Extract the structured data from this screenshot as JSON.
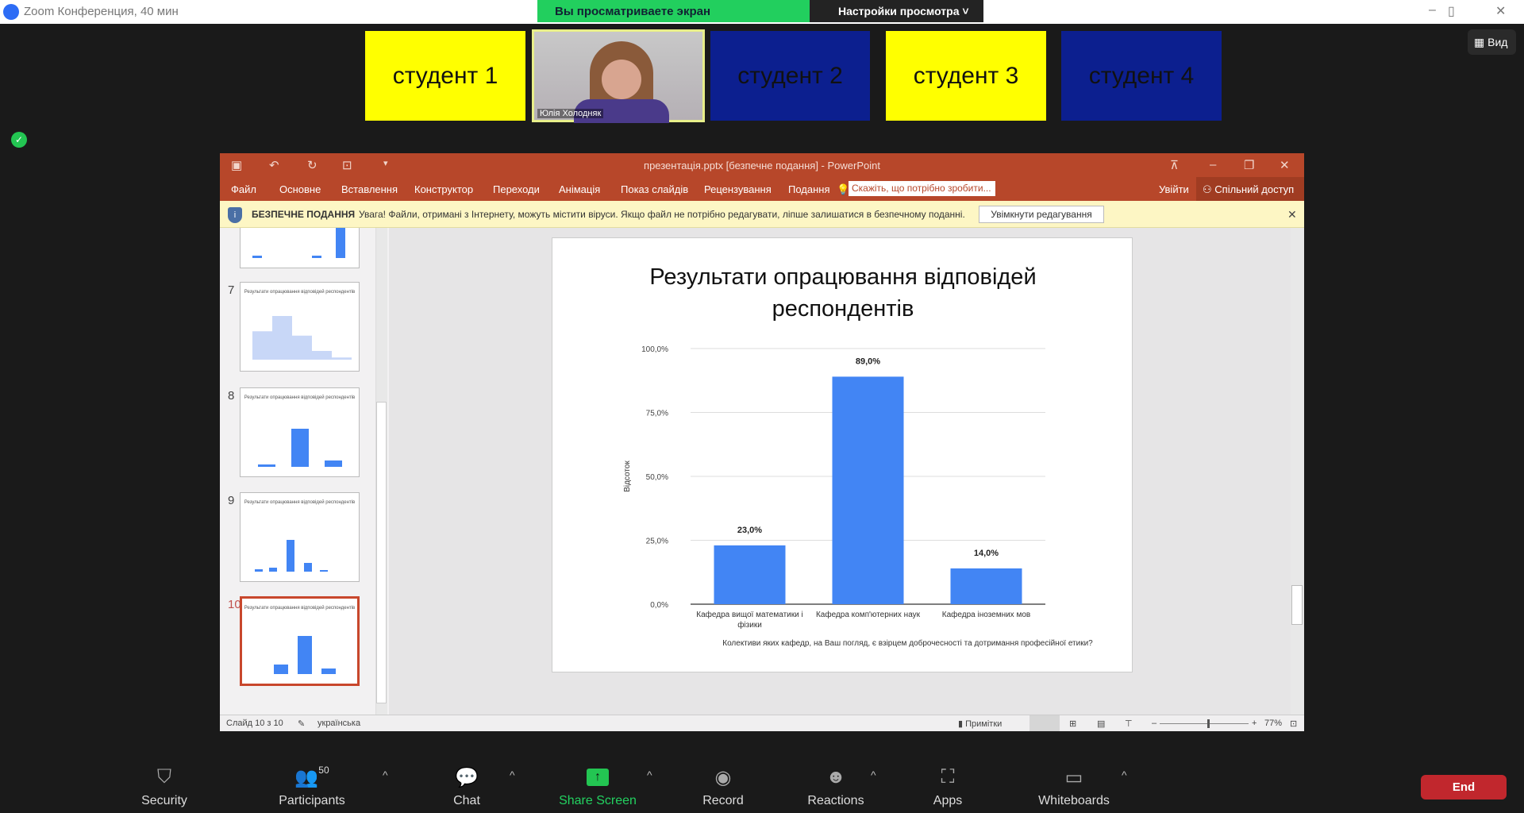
{
  "zoom": {
    "title": "Zoom Конференция, 40 мин",
    "logo": "zoom",
    "viewing_banner": "Вы просматриваете экран",
    "view_settings": "Настройки просмотра",
    "view_button": "Вид"
  },
  "tiles": [
    {
      "label": "студент 1",
      "color": "#ffff00"
    },
    {
      "label": "Юлія Холодняк",
      "color": "video"
    },
    {
      "label": "студент 2",
      "color": "#0c1f8f"
    },
    {
      "label": "студент 3",
      "color": "#ffff00"
    },
    {
      "label": "студент 4",
      "color": "#0c1f8f"
    }
  ],
  "ppt": {
    "title": "презентація.pptx [безпечне подання] - PowerPoint",
    "tabs": [
      "Файл",
      "Основне",
      "Вставлення",
      "Конструктор",
      "Переходи",
      "Анімація",
      "Показ слайдів",
      "Рецензування",
      "Подання"
    ],
    "tell_me": "Скажіть, що потрібно зробити...",
    "signin": "Увійти",
    "share": "Спільний доступ",
    "protected": {
      "title": "БЕЗПЕЧНЕ ПОДАННЯ",
      "message": "Увага! Файли, отримані з Інтернету, можуть містити віруси. Якщо файл не потрібно редагувати, ліпше залишатися в безпечному поданні.",
      "button": "Увімкнути редагування"
    },
    "thumbnails": [
      {
        "num": "7"
      },
      {
        "num": "8"
      },
      {
        "num": "9"
      },
      {
        "num": "10",
        "selected": true
      }
    ],
    "thumb_title": "Результати опрацювання відповідей респондентів",
    "status": {
      "slide": "Слайд 10 з 10",
      "language": "українська",
      "notes": "Примітки",
      "zoom": "77%",
      "zoom_fraction": 0.77
    }
  },
  "chart_data": {
    "type": "bar",
    "title": "Результати опрацювання відповідей респондентів",
    "categories": [
      "Кафедра вищої математики і фізики",
      "Кафедра комп'ютерних наук",
      "Кафедра іноземних мов"
    ],
    "values": [
      23.0,
      89.0,
      14.0
    ],
    "value_labels": [
      "23,0%",
      "89,0%",
      "14,0%"
    ],
    "ylabel": "Відсоток",
    "xlabel": "Колективи яких кафедр, на Ваш погляд, є взірцем доброчесності та дотримання професійної етики?",
    "ylim": [
      0,
      100
    ],
    "yticks": [
      "0,0%",
      "25,0%",
      "50,0%",
      "75,0%",
      "100,0%"
    ],
    "grid": true,
    "bar_color": "#4285f4"
  },
  "toolbar": {
    "items": [
      "Security",
      "Participants",
      "Chat",
      "Share Screen",
      "Record",
      "Reactions",
      "Apps",
      "Whiteboards"
    ],
    "participants_count": "50",
    "end": "End"
  }
}
